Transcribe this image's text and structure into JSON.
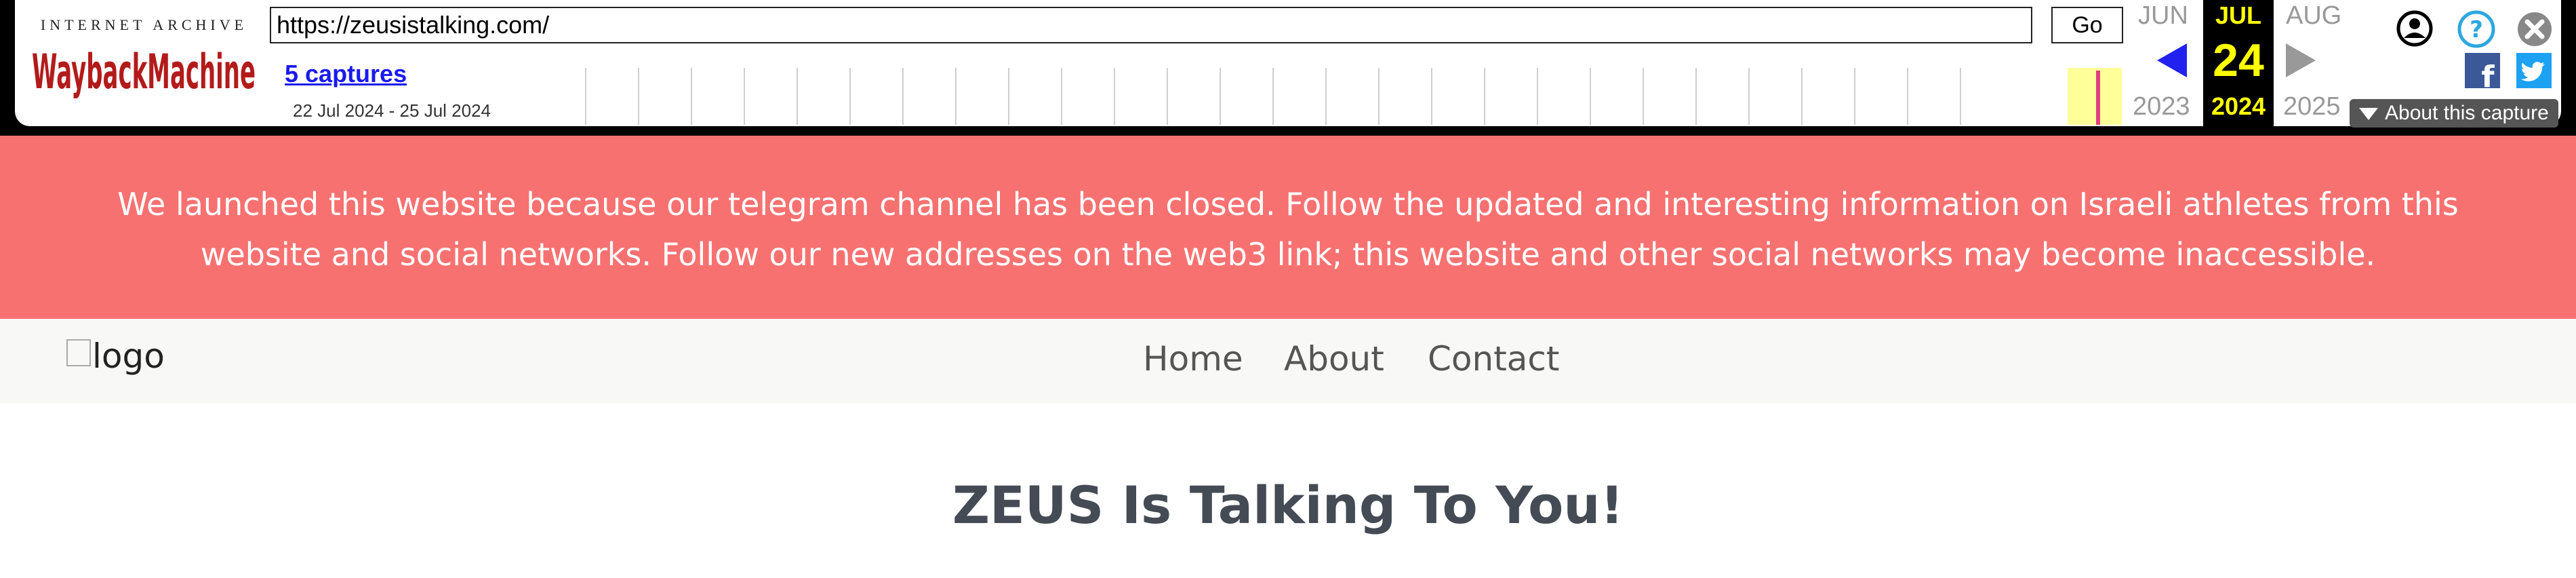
{
  "wayback": {
    "logo_top": "INTERNET ARCHIVE",
    "logo_main": "WaybackMachine",
    "url": "https://zeusistalking.com/",
    "go_label": "Go",
    "captures_label": "5 captures",
    "date_range": "22 Jul 2024 - 25 Jul 2024",
    "prev_month": "JUN",
    "prev_year": "2023",
    "cur_month": "JUL",
    "cur_day": "24",
    "cur_year": "2024",
    "next_month": "AUG",
    "next_year": "2025",
    "about_label": "About this capture",
    "colors": {
      "accent": "#ffff00",
      "facebook": "#3b5998",
      "twitter": "#1da1f2",
      "help": "#2ca7e0",
      "prev_arrow": "#2222ee",
      "next_arrow": "#999999"
    }
  },
  "banner": {
    "text": "We launched this website because our telegram channel has been closed. Follow the updated and interesting information on Israeli athletes from this website and social networks. Follow our new addresses on the web3 link; this website and other social networks may become inaccessible.",
    "color": "#f87171"
  },
  "navbar": {
    "logo_alt": "logo",
    "links": [
      "Home",
      "About",
      "Contact"
    ]
  },
  "hero": {
    "title": "ZEUS Is Talking To You!"
  }
}
